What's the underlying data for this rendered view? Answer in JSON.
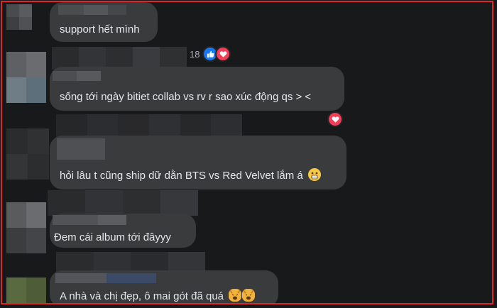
{
  "comments": [
    {
      "text": "support hết mình"
    },
    {
      "text": "sống tới ngày bitiet collab vs rv r sao xúc động qs > <",
      "reaction_count": "18",
      "reactions": [
        "like-icon",
        "heart-icon"
      ]
    },
    {
      "text": "hỏi lâu t cũng ship dữ dằn BTS vs Red Velvet lắm á",
      "emoji": "surprised-face-emoji",
      "reactions": [
        "heart-icon"
      ]
    },
    {
      "text": "Đem cái album tới đâyyy"
    },
    {
      "text": "A nhà và chị đẹp, ô mai gót đã quá",
      "emoji": "weary-cat-emoji"
    }
  ],
  "colors": {
    "background": "#18191a",
    "bubble": "#3a3b3c",
    "text": "#e4e6eb",
    "border": "#e0262c",
    "like": "#1877f2",
    "heart": "#f33e58"
  }
}
